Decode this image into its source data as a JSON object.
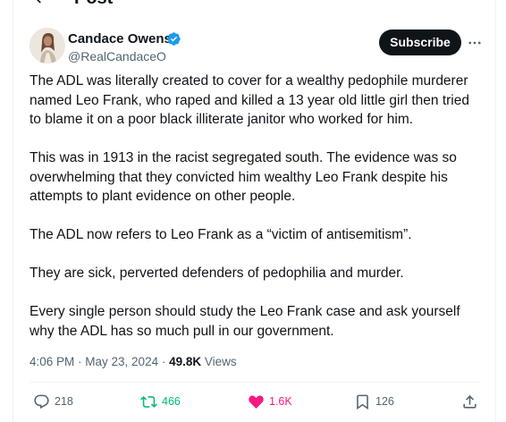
{
  "topbar": {
    "title": "Post"
  },
  "author": {
    "name": "Candace Owens",
    "handle": "@RealCandaceO",
    "verified_color": "#1d9bf0"
  },
  "header": {
    "subscribe_label": "Subscribe"
  },
  "tweet": {
    "paragraphs": [
      "The ADL was literally created to cover for a wealthy pedophile murderer named Leo Frank, who raped and killed a 13 year old little girl then tried to blame it on a poor black illiterate janitor who worked for him.",
      "This was in 1913 in the racist segregated south. The evidence was so overwhelming that they convicted him wealthy Leo Frank despite his attempts to plant evidence on other people.",
      "The ADL now refers to Leo Frank as a “victim of antisemitism”.",
      "They are sick, perverted defenders of pedophilia and murder.",
      "Every single person should study the Leo Frank case and ask yourself why the ADL has so much pull in our government."
    ]
  },
  "meta": {
    "time": "4:06 PM",
    "separator": " · ",
    "date": "May 23, 2024",
    "views_count": "49.8K",
    "views_label": " Views"
  },
  "actions": {
    "replies": "218",
    "reposts": "466",
    "likes": "1.6K",
    "bookmarks": "126"
  },
  "colors": {
    "text": "#0f1419",
    "muted": "#536471",
    "repost": "#00ba7c",
    "like": "#f91880",
    "accent": "#1d9bf0"
  },
  "icons": [
    "back-arrow-icon",
    "verified-badge-icon",
    "more-icon",
    "reply-icon",
    "repost-icon",
    "heart-icon",
    "bookmark-icon",
    "share-icon"
  ]
}
